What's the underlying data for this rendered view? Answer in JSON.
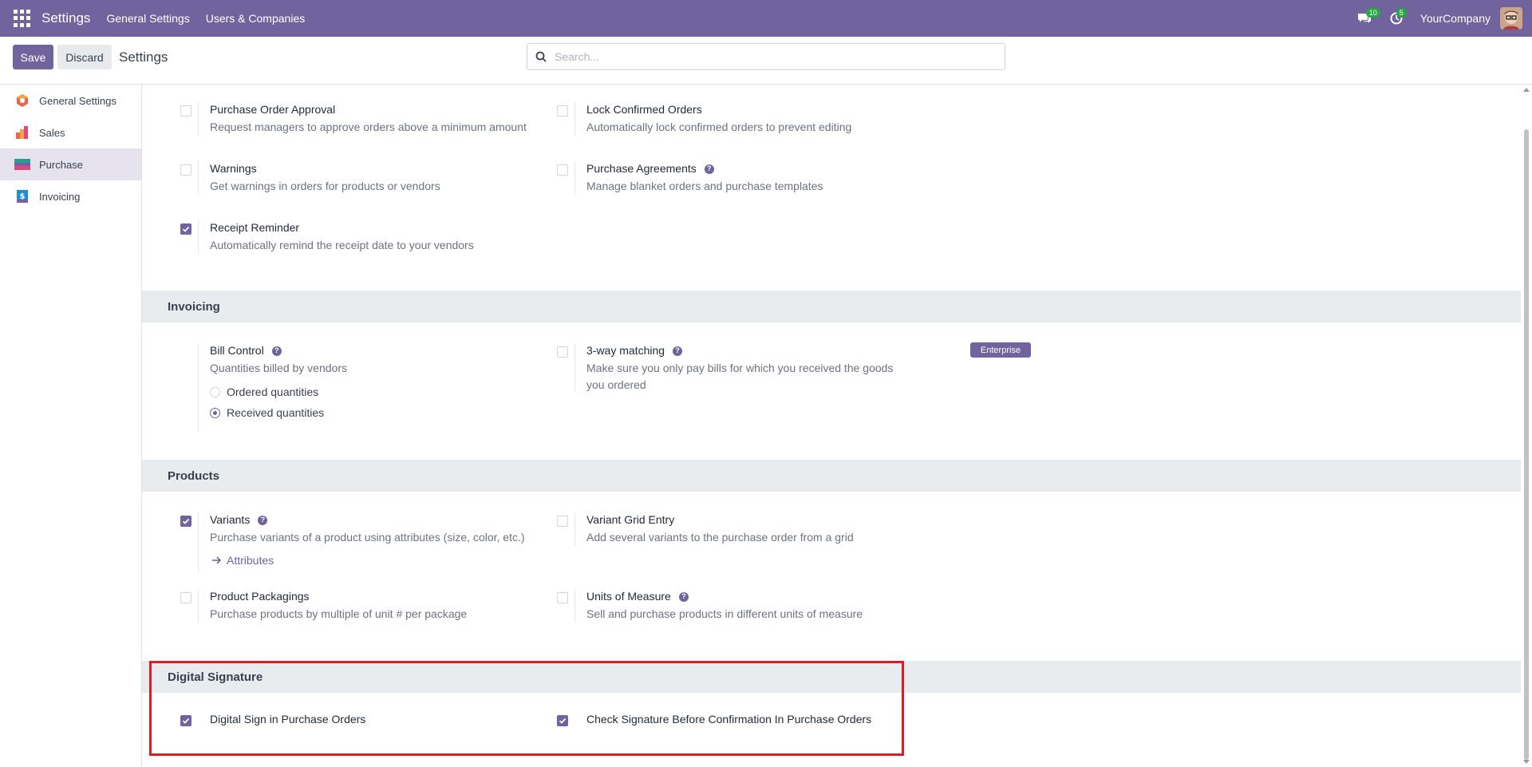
{
  "navbar": {
    "brand": "Settings",
    "menus": [
      "General Settings",
      "Users & Companies"
    ],
    "messages_count": "10",
    "activities_count": "5",
    "company": "YourCompany"
  },
  "control_panel": {
    "save_label": "Save",
    "discard_label": "Discard",
    "title": "Settings",
    "search_placeholder": "Search..."
  },
  "sidebar": {
    "items": [
      {
        "label": "General Settings",
        "icon": "general-settings-icon"
      },
      {
        "label": "Sales",
        "icon": "sales-icon"
      },
      {
        "label": "Purchase",
        "icon": "purchase-icon",
        "active": true
      },
      {
        "label": "Invoicing",
        "icon": "invoicing-icon"
      }
    ]
  },
  "orders": {
    "purchase_order_approval": {
      "title": "Purchase Order Approval",
      "desc": "Request managers to approve orders above a minimum amount",
      "checked": false
    },
    "lock_confirmed_orders": {
      "title": "Lock Confirmed Orders",
      "desc": "Automatically lock confirmed orders to prevent editing",
      "checked": false
    },
    "warnings": {
      "title": "Warnings",
      "desc": "Get warnings in orders for products or vendors",
      "checked": false
    },
    "purchase_agreements": {
      "title": "Purchase Agreements",
      "desc": "Manage blanket orders and purchase templates",
      "checked": false
    },
    "receipt_reminder": {
      "title": "Receipt Reminder",
      "desc": "Automatically remind the receipt date to your vendors",
      "checked": true
    }
  },
  "invoicing": {
    "heading": "Invoicing",
    "bill_control": {
      "title": "Bill Control",
      "desc": "Quantities billed by vendors",
      "options": [
        "Ordered quantities",
        "Received quantities"
      ],
      "selected": "Received quantities"
    },
    "three_way_matching": {
      "title": "3-way matching",
      "desc_line1": "Make sure you only pay bills for which you received the goods",
      "desc_line2": "you ordered",
      "badge": "Enterprise",
      "checked": false
    }
  },
  "products": {
    "heading": "Products",
    "variants": {
      "title": "Variants",
      "desc": "Purchase variants of a product using attributes (size, color, etc.)",
      "checked": true,
      "link": "Attributes"
    },
    "variant_grid_entry": {
      "title": "Variant Grid Entry",
      "desc": "Add several variants to the purchase order from a grid",
      "checked": false
    },
    "product_packagings": {
      "title": "Product Packagings",
      "desc": "Purchase products by multiple of unit # per package",
      "checked": false
    },
    "units_of_measure": {
      "title": "Units of Measure",
      "desc": "Sell and purchase products in different units of measure",
      "checked": false
    }
  },
  "digital_signature": {
    "heading": "Digital Signature",
    "digital_sign": {
      "title": "Digital Sign in Purchase Orders",
      "checked": true
    },
    "check_signature": {
      "title": "Check Signature Before Confirmation In Purchase Orders",
      "checked": true
    }
  },
  "colors": {
    "brand": "#71639e",
    "highlight": "#e01b24",
    "badge_green": "#28a745"
  }
}
